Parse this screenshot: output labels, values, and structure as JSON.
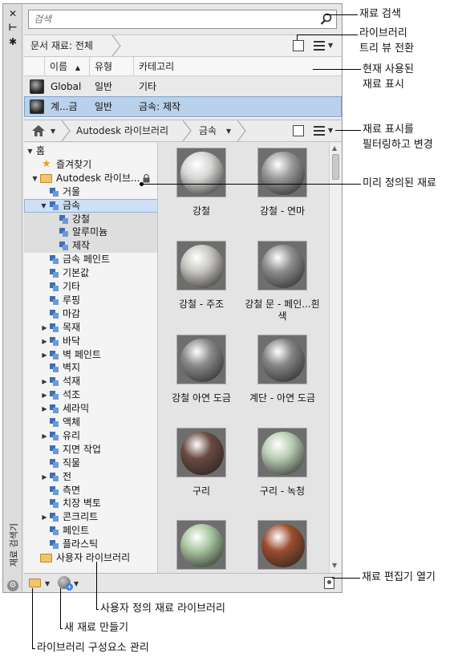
{
  "strip": {
    "close": "✕",
    "auto_hide": "⊢",
    "settings": "✱",
    "title": "재료 검색기"
  },
  "search": {
    "placeholder": "검색"
  },
  "doc_bar": {
    "label": "문서 재료: 전체"
  },
  "table": {
    "columns": [
      "이름",
      "유형",
      "카테고리"
    ],
    "sort_indicator": "▲",
    "rows": [
      {
        "name": "Global",
        "type": "일반",
        "category": "기타",
        "selected": false
      },
      {
        "name": "계...금",
        "type": "일반",
        "category": "금속: 제작",
        "selected": true
      }
    ]
  },
  "lib_bar": {
    "crumb1": "Autodesk 라이브러리",
    "crumb2": "금속"
  },
  "tree": {
    "home": "홈",
    "favorites": "즐겨찾기",
    "autodesk_lib": "Autodesk 라이브...",
    "items": [
      {
        "label": "거울",
        "expandable": false
      },
      {
        "label": "금속",
        "expandable": true,
        "expanded": true,
        "selected": true
      },
      {
        "label": "강철",
        "expandable": false,
        "child": true
      },
      {
        "label": "알루미늄",
        "expandable": false,
        "child": true
      },
      {
        "label": "제작",
        "expandable": false,
        "child": true
      },
      {
        "label": "금속 페인트",
        "expandable": false
      },
      {
        "label": "기본값",
        "expandable": false
      },
      {
        "label": "기타",
        "expandable": false
      },
      {
        "label": "루핑",
        "expandable": false
      },
      {
        "label": "마감",
        "expandable": false
      },
      {
        "label": "목재",
        "expandable": true
      },
      {
        "label": "바닥",
        "expandable": true
      },
      {
        "label": "벽 페인트",
        "expandable": true
      },
      {
        "label": "벽지",
        "expandable": false
      },
      {
        "label": "석재",
        "expandable": true
      },
      {
        "label": "석조",
        "expandable": true
      },
      {
        "label": "세라믹",
        "expandable": true
      },
      {
        "label": "액체",
        "expandable": false
      },
      {
        "label": "유리",
        "expandable": true
      },
      {
        "label": "지면 작업",
        "expandable": false
      },
      {
        "label": "직물",
        "expandable": false
      },
      {
        "label": "전",
        "expandable": true
      },
      {
        "label": "측면",
        "expandable": false
      },
      {
        "label": "치장 벽토",
        "expandable": false
      },
      {
        "label": "콘크리트",
        "expandable": true
      },
      {
        "label": "페인트",
        "expandable": false
      },
      {
        "label": "플라스틱",
        "expandable": false
      }
    ],
    "user_lib": "사용자 라이브러리"
  },
  "thumbnails": [
    {
      "label": "강철",
      "color": "#d6d6d4"
    },
    {
      "label": "강철 - 연마",
      "color": "#9a9a9a"
    },
    {
      "label": "강철 - 주조",
      "color": "#c8c6c0"
    },
    {
      "label": "강철 문 - 페인...흰색",
      "color": "#8e8e8e"
    },
    {
      "label": "강철 아연 도금",
      "color": "#8a8a8a"
    },
    {
      "label": "계단 - 아연 도금",
      "color": "#858585"
    },
    {
      "label": "구리",
      "color": "#6b4a42"
    },
    {
      "label": "구리 - 녹청",
      "color": "#b9cdb4"
    },
    {
      "label": "",
      "color": "#a8c6a0"
    },
    {
      "label": "",
      "color": "#9c4e2e"
    }
  ],
  "callouts": {
    "search": "재료 검색",
    "tree_toggle": "라이브러리\n트리 뷰 전환",
    "current_used": "현재 사용된\n재료 표시",
    "filter_view": "재료 표시를\n필터링하고 변경",
    "predefined": "미리 정의된 재료",
    "open_editor": "재료 편집기 열기",
    "user_library": "사용자 정의 재료 라이브러리",
    "new_material": "새 재료 만들기",
    "manage_library": "라이브러리 구성요소 관리"
  }
}
